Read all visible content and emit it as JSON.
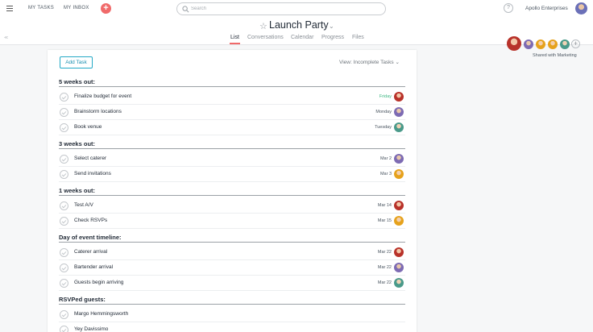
{
  "topbar": {
    "my_tasks": "MY TASKS",
    "my_inbox": "MY INBOX",
    "search_placeholder": "Search",
    "help": "?",
    "org_name": "Apollo Enterprises"
  },
  "project": {
    "title": "Launch Party",
    "tabs": [
      "List",
      "Conversations",
      "Calendar",
      "Progress",
      "Files"
    ],
    "active_tab": "List",
    "shared_with": "Shared with Marketing"
  },
  "list": {
    "add_task_label": "Add Task",
    "view_label": "View: Incomplete Tasks",
    "sections": [
      {
        "title": "5 weeks out:",
        "tasks": [
          {
            "name": "Finalize budget for event",
            "due": "Friday",
            "due_color": "#3fb883",
            "assignee": "red"
          },
          {
            "name": "Brainstorm locations",
            "due": "Monday",
            "assignee": "purple"
          },
          {
            "name": "Book venue",
            "due": "Tuesday",
            "assignee": "teal"
          }
        ]
      },
      {
        "title": "3 weeks out:",
        "tasks": [
          {
            "name": "Select caterer",
            "due": "Mar 2",
            "assignee": "purple"
          },
          {
            "name": "Send invitations",
            "due": "Mar 3",
            "assignee": "orange"
          }
        ]
      },
      {
        "title": "1 weeks out:",
        "tasks": [
          {
            "name": "Test A/V",
            "due": "Mar 14",
            "assignee": "red"
          },
          {
            "name": "Check RSVPs",
            "due": "Mar 15",
            "assignee": "orange"
          }
        ]
      },
      {
        "title": "Day of event timeline:",
        "tasks": [
          {
            "name": "Caterer arrival",
            "due": "Mar 22",
            "assignee": "red"
          },
          {
            "name": "Bartender arrival",
            "due": "Mar 22",
            "assignee": "purple"
          },
          {
            "name": "Guests begin arriving",
            "due": "Mar 22",
            "assignee": "teal"
          }
        ]
      },
      {
        "title": "RSVPed guests:",
        "tasks": [
          {
            "name": "Margo Hemmingsworth",
            "due": "",
            "assignee": ""
          },
          {
            "name": "Yey Davissimo",
            "due": "",
            "assignee": ""
          }
        ]
      }
    ]
  },
  "colors": {
    "accent": "#f06a6a",
    "add_task_border": "#24a9c6",
    "due_soon": "#3fb883"
  }
}
